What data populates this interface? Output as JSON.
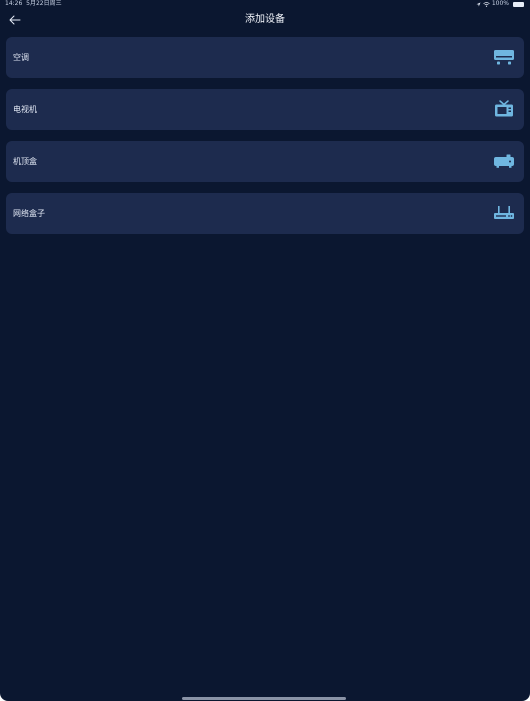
{
  "status_bar": {
    "time": "14:26",
    "date": "5月22日周三",
    "battery": "100%"
  },
  "header": {
    "title": "添加设备"
  },
  "devices": [
    {
      "label": "空调",
      "icon": "air-conditioner-icon"
    },
    {
      "label": "电视机",
      "icon": "tv-icon"
    },
    {
      "label": "机顶盒",
      "icon": "set-top-box-icon"
    },
    {
      "label": "网络盒子",
      "icon": "router-icon"
    }
  ],
  "colors": {
    "background": "#0b1730",
    "card": "#1d2b4e",
    "icon": "#6fb6e0"
  }
}
